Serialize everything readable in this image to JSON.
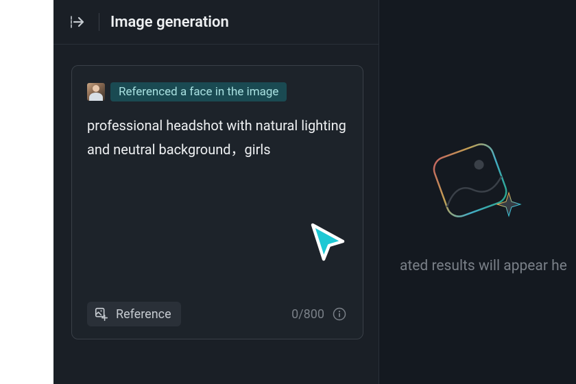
{
  "header": {
    "title": "Image generation"
  },
  "promptCard": {
    "referenceChip": "Referenced a face in the image",
    "promptText": "professional headshot with natural lighting and neutral background，girls",
    "referenceButton": "Reference",
    "charCounter": "0/800"
  },
  "resultsArea": {
    "placeholderText": "ated results will appear he"
  }
}
